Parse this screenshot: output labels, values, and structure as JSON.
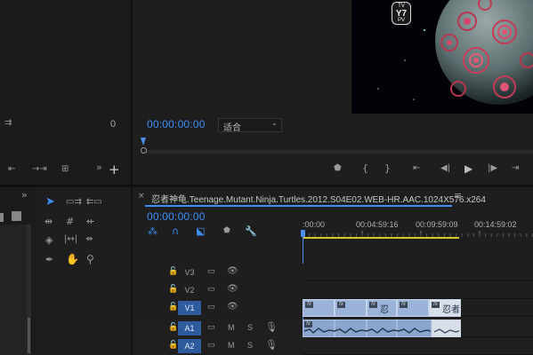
{
  "program_monitor": {
    "timecode": "00:00:00:00",
    "fit_label": "适合",
    "left_count": "0",
    "video_badge": {
      "top": "TV",
      "mid": "Y7",
      "bottom": "PV"
    }
  },
  "timeline": {
    "tab_title": "忍者神龟.Teenage.Mutant.Ninja.Turtles.2012.S04E02.WEB-HR.AAC.1024X576.x264",
    "menu_icon": "hamburger-icon",
    "timecode": "00:00:00:00",
    "ruler": [
      ":00:00",
      "00:04:59:16",
      "00:09:59:09",
      "00:14:59:02"
    ],
    "tracks": [
      {
        "name": "V3",
        "type": "video",
        "active": false
      },
      {
        "name": "V2",
        "type": "video",
        "active": false
      },
      {
        "name": "V1",
        "type": "video",
        "active": true
      },
      {
        "name": "A1",
        "type": "audio",
        "active": true
      },
      {
        "name": "A2",
        "type": "audio",
        "active": true
      }
    ],
    "audio_buttons": {
      "mute": "M",
      "solo": "S"
    },
    "clip_labels": [
      "fx",
      "fx",
      "fx 忍者",
      "fx",
      "fx",
      "fx 忍者",
      "fx"
    ]
  },
  "colors": {
    "accent": "#3d8ff5",
    "clip_video": "#9bb3d8",
    "clip_audio": "#8aa6cf",
    "playhead": "#4b8ff0",
    "work_area": "#d6c62a"
  }
}
